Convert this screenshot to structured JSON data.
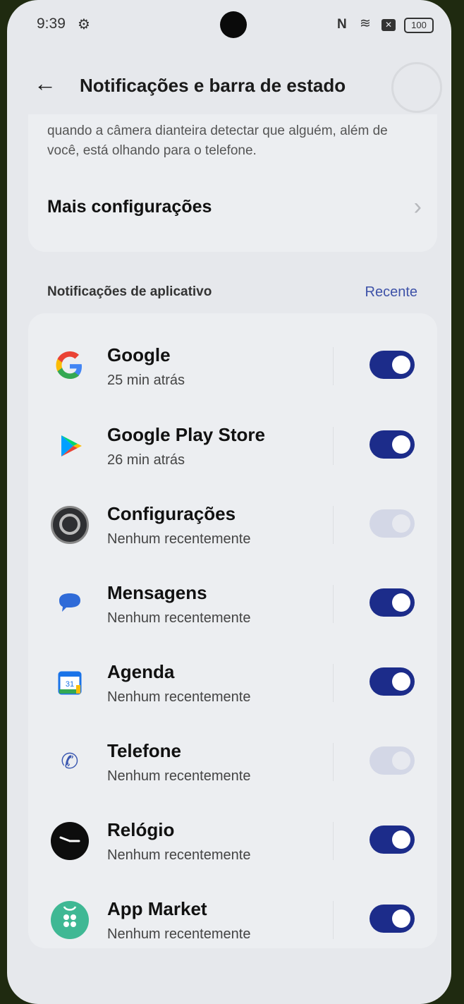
{
  "status_bar": {
    "time": "9:39",
    "battery": "100"
  },
  "header": {
    "title": "Notificações e barra de estado"
  },
  "top_card": {
    "description": "quando a câmera dianteira detectar que alguém, além de você, está olhando para o telefone.",
    "more_settings_label": "Mais configurações"
  },
  "app_notifications": {
    "section_title": "Notificações de aplicativo",
    "sort_label": "Recente",
    "apps": [
      {
        "name": "Google",
        "time": "25 min atrás",
        "enabled": true,
        "icon": "google-icon"
      },
      {
        "name": "Google Play Store",
        "time": "26 min atrás",
        "enabled": true,
        "icon": "play-store-icon"
      },
      {
        "name": "Configurações",
        "time": "Nenhum recentemente",
        "enabled": true,
        "dimmed": true,
        "icon": "settings-gear-icon"
      },
      {
        "name": "Mensagens",
        "time": "Nenhum recentemente",
        "enabled": true,
        "icon": "messages-icon"
      },
      {
        "name": "Agenda",
        "time": "Nenhum recentemente",
        "enabled": true,
        "icon": "calendar-icon"
      },
      {
        "name": "Telefone",
        "time": "Nenhum recentemente",
        "enabled": true,
        "dimmed": true,
        "icon": "phone-icon"
      },
      {
        "name": "Relógio",
        "time": "Nenhum recentemente",
        "enabled": true,
        "icon": "clock-icon"
      },
      {
        "name": "App Market",
        "time": "Nenhum recentemente",
        "enabled": true,
        "icon": "app-market-icon"
      }
    ]
  },
  "calendar_icon_text": "31",
  "colors": {
    "toggle_on": "#1c2c8a",
    "accent_link": "#3e52a8",
    "background": "#e6e8ec"
  }
}
